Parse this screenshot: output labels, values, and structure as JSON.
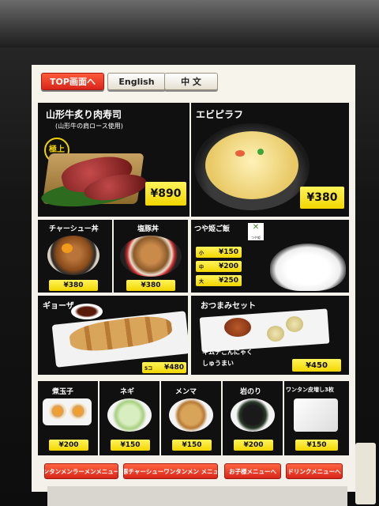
{
  "topbar": {
    "top_button": "TOP画面へ",
    "english_button": "English",
    "chinese_button": "中 文"
  },
  "featured": {
    "yamagata": {
      "name": "山形牛炙り肉寿司",
      "sub": "(山形牛の肩ロース使用)",
      "badge": "極上",
      "price": "¥890"
    },
    "pilaf": {
      "name": "エビピラフ",
      "price": "¥380"
    }
  },
  "row2": {
    "chashu": {
      "name": "チャーシュー丼",
      "price": "¥380"
    },
    "shiobuta": {
      "name": "塩豚丼",
      "price": "¥380"
    },
    "tsuyahime": {
      "name": "つや姫ご飯",
      "logo_text": "つや姫",
      "sizes": [
        {
          "size": "小",
          "price": "¥150"
        },
        {
          "size": "中",
          "price": "¥200"
        },
        {
          "size": "大",
          "price": "¥250"
        }
      ]
    }
  },
  "row3": {
    "gyoza": {
      "name": "ギョーザ",
      "count": "5コ",
      "price": "¥480"
    },
    "otsumami": {
      "name": "おつまみセット",
      "desc_1": "キムチこんにゃく",
      "desc_2": "しゅうまい",
      "price": "¥450"
    }
  },
  "row4": [
    {
      "name": "煮玉子",
      "price": "¥200"
    },
    {
      "name": "ネギ",
      "price": "¥150"
    },
    {
      "name": "メンマ",
      "price": "¥150"
    },
    {
      "name": "岩のり",
      "price": "¥200"
    },
    {
      "name": "ワンタン皮増し3枚",
      "price": "¥150"
    }
  ],
  "bottom_nav": [
    "ワンタンメンラーメンメニューへ",
    "金華豚チャーシューワンタンメン メニューへ",
    "お子様メニューへ",
    "ドリンクメニューへ"
  ],
  "colors": {
    "accent_red": "#d8261a",
    "price_yellow": "#f2d600",
    "panel_black": "#101010",
    "screen_bg": "#f4f1ea"
  }
}
